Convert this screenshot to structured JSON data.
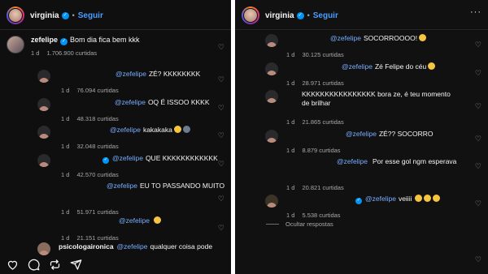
{
  "left": {
    "header": {
      "username": "virginia",
      "separator": "•",
      "follow_label": "Seguir"
    },
    "main_comment": {
      "username": "zefelipe",
      "text": "Bom dia fica bem kkk",
      "time": "1 d",
      "likes": "1.706.900 curtidas"
    },
    "replies": [
      {
        "mention": "@zefelipe",
        "text": "ZÉ? KKKKKKKK",
        "time": "1 d",
        "likes": "76.094 curtidas"
      },
      {
        "mention": "@zefelipe",
        "text": "OQ É ISSOO KKKK",
        "time": "1 d",
        "likes": "48.318 curtidas"
      },
      {
        "mention": "@zefelipe",
        "text": "kakakaka",
        "time": "1 d",
        "likes": "32.048 curtidas"
      },
      {
        "mention": "@zefelipe",
        "text": "QUE KKKKKKKKKKKK",
        "time": "1 d",
        "likes": "42.570 curtidas"
      },
      {
        "mention": "@zefelipe",
        "text": "EU TO PASSANDO MUITO",
        "time": "1 d",
        "likes": "51.971 curtidas"
      },
      {
        "mention": "@zefelipe",
        "text": "",
        "time": "1 d",
        "likes": "21.151 curtidas"
      }
    ],
    "partial_comment": {
      "username": "psicologaironica",
      "mention": "@zefelipe",
      "text": "qualquer coisa pode"
    }
  },
  "right": {
    "header": {
      "username": "virginia",
      "separator": "•",
      "follow_label": "Seguir"
    },
    "replies": [
      {
        "mention": "@zefelipe",
        "text": "SOCORROOOO!",
        "time": "1 d",
        "likes": "30.125 curtidas"
      },
      {
        "mention": "@zefelipe",
        "text": "Zé Felipe do céu",
        "time": "1 d",
        "likes": "28.971 curtidas"
      },
      {
        "mention": "",
        "text": "KKKKKKKKKKKKKKKK bora ze, é teu momento de brilhar",
        "time": "1 d",
        "likes": "21.865 curtidas"
      },
      {
        "mention": "@zefelipe",
        "text": "ZÉ?? SOCORRO",
        "time": "1 d",
        "likes": "8.879 curtidas"
      },
      {
        "mention": "@zefelipe",
        "text": "Por esse gol ngm esperava",
        "time": "1 d",
        "likes": "20.821 curtidas"
      },
      {
        "mention": "@zefelipe",
        "text": "veiiii",
        "time": "1 d",
        "likes": "5.538 curtidas"
      }
    ],
    "hide_replies_label": "Ocultar respostas"
  },
  "icons": [
    "heart-icon",
    "comment-icon",
    "repost-icon",
    "share-icon",
    "more-icon",
    "verified-icon"
  ],
  "colors": {
    "background": "#0f0f10",
    "mention": "#78aefe",
    "follow": "#4a9eff",
    "verified": "#0095f6",
    "meta": "#a8a8a8"
  }
}
